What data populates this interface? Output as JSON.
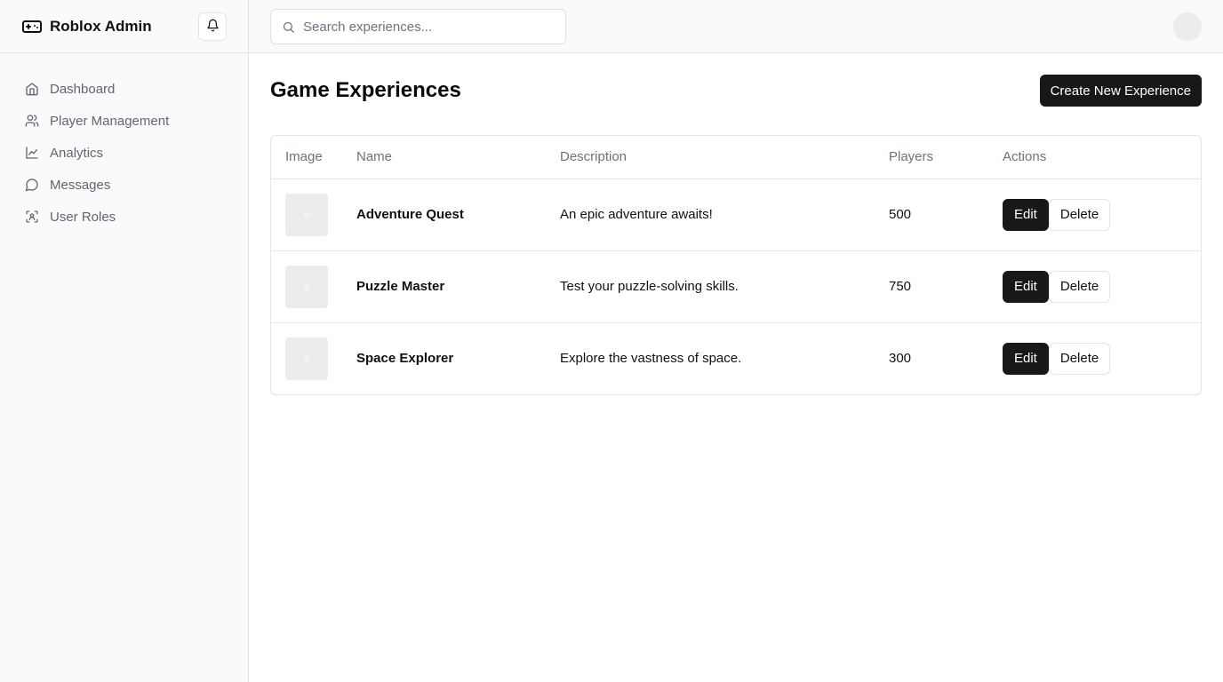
{
  "app": {
    "title": "Roblox Admin",
    "brand_icon": "gamepad-icon",
    "notification_icon": "bell-icon"
  },
  "sidebar": {
    "items": [
      {
        "label": "Dashboard",
        "icon": "home-icon"
      },
      {
        "label": "Player Management",
        "icon": "users-icon"
      },
      {
        "label": "Analytics",
        "icon": "line-chart-icon"
      },
      {
        "label": "Messages",
        "icon": "message-circle-icon"
      },
      {
        "label": "User Roles",
        "icon": "scan-user-icon"
      }
    ]
  },
  "header": {
    "search_placeholder": "Search experiences...",
    "search_value": ""
  },
  "main": {
    "title": "Game Experiences",
    "create_label": "Create New Experience",
    "table": {
      "columns": [
        "Image",
        "Name",
        "Description",
        "Players",
        "Actions"
      ],
      "rows": [
        {
          "name": "Adventure Quest",
          "description": "An epic adventure awaits!",
          "players": "500",
          "edit_label": "Edit",
          "delete_label": "Delete"
        },
        {
          "name": "Puzzle Master",
          "description": "Test your puzzle-solving skills.",
          "players": "750",
          "edit_label": "Edit",
          "delete_label": "Delete"
        },
        {
          "name": "Space Explorer",
          "description": "Explore the vastness of space.",
          "players": "300",
          "edit_label": "Edit",
          "delete_label": "Delete"
        }
      ]
    }
  },
  "colors": {
    "primary_button": "#18181b",
    "muted_text": "#6b7280",
    "border": "#e5e5e5",
    "sidebar_bg": "#fafafa"
  }
}
